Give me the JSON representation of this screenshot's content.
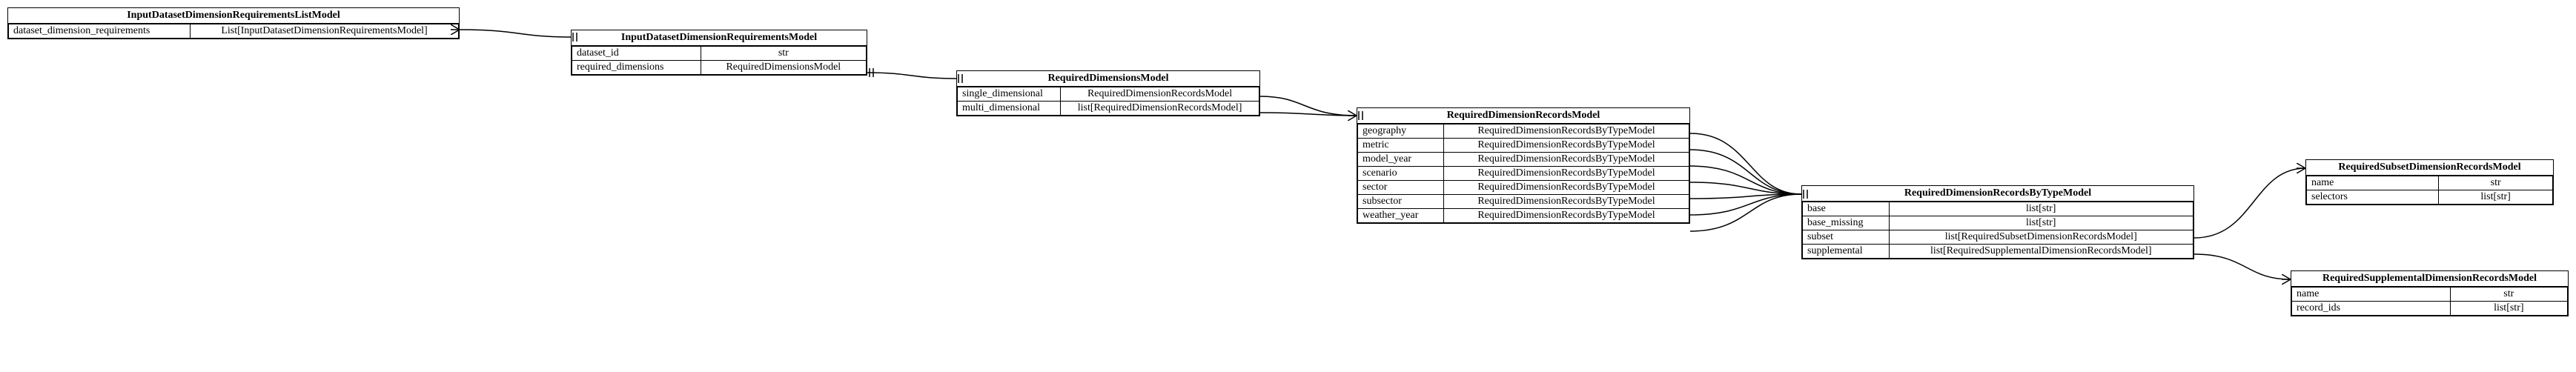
{
  "entities": {
    "listModel": {
      "title": "InputDatasetDimensionRequirementsListModel",
      "rows": [
        {
          "name": "dataset_dimension_requirements",
          "type": "List[InputDatasetDimensionRequirementsModel]"
        }
      ]
    },
    "reqModel": {
      "title": "InputDatasetDimensionRequirementsModel",
      "rows": [
        {
          "name": "dataset_id",
          "type": "str"
        },
        {
          "name": "required_dimensions",
          "type": "RequiredDimensionsModel"
        }
      ]
    },
    "dimsModel": {
      "title": "RequiredDimensionsModel",
      "rows": [
        {
          "name": "single_dimensional",
          "type": "RequiredDimensionRecordsModel"
        },
        {
          "name": "multi_dimensional",
          "type": "list[RequiredDimensionRecordsModel]"
        }
      ]
    },
    "recordsModel": {
      "title": "RequiredDimensionRecordsModel",
      "rows": [
        {
          "name": "geography",
          "type": "RequiredDimensionRecordsByTypeModel"
        },
        {
          "name": "metric",
          "type": "RequiredDimensionRecordsByTypeModel"
        },
        {
          "name": "model_year",
          "type": "RequiredDimensionRecordsByTypeModel"
        },
        {
          "name": "scenario",
          "type": "RequiredDimensionRecordsByTypeModel"
        },
        {
          "name": "sector",
          "type": "RequiredDimensionRecordsByTypeModel"
        },
        {
          "name": "subsector",
          "type": "RequiredDimensionRecordsByTypeModel"
        },
        {
          "name": "weather_year",
          "type": "RequiredDimensionRecordsByTypeModel"
        }
      ]
    },
    "byTypeModel": {
      "title": "RequiredDimensionRecordsByTypeModel",
      "rows": [
        {
          "name": "base",
          "type": "list[str]"
        },
        {
          "name": "base_missing",
          "type": "list[str]"
        },
        {
          "name": "subset",
          "type": "list[RequiredSubsetDimensionRecordsModel]"
        },
        {
          "name": "supplemental",
          "type": "list[RequiredSupplementalDimensionRecordsModel]"
        }
      ]
    },
    "subsetModel": {
      "title": "RequiredSubsetDimensionRecordsModel",
      "rows": [
        {
          "name": "name",
          "type": "str"
        },
        {
          "name": "selectors",
          "type": "list[str]"
        }
      ]
    },
    "supplementalModel": {
      "title": "RequiredSupplementalDimensionRecordsModel",
      "rows": [
        {
          "name": "name",
          "type": "str"
        },
        {
          "name": "record_ids",
          "type": "list[str]"
        }
      ]
    }
  }
}
